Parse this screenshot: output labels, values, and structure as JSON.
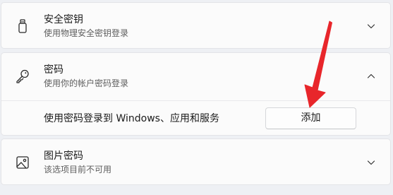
{
  "security_key": {
    "title": "安全密钥",
    "subtitle": "使用物理安全密钥登录",
    "icon": "usb-key-icon",
    "expanded": false
  },
  "password": {
    "title": "密码",
    "subtitle": "使用你的帐户密码登录",
    "icon": "key-icon",
    "expanded": true,
    "setting_text": "使用密码登录到 Windows、应用和服务",
    "add_button_label": "添加"
  },
  "picture_password": {
    "title": "图片密码",
    "subtitle": "该选项目前不可用",
    "icon": "picture-icon",
    "expanded": false
  },
  "colors": {
    "background": "#eef0f4",
    "card": "#fbfbfb",
    "annotation_arrow": "#e8262b"
  }
}
